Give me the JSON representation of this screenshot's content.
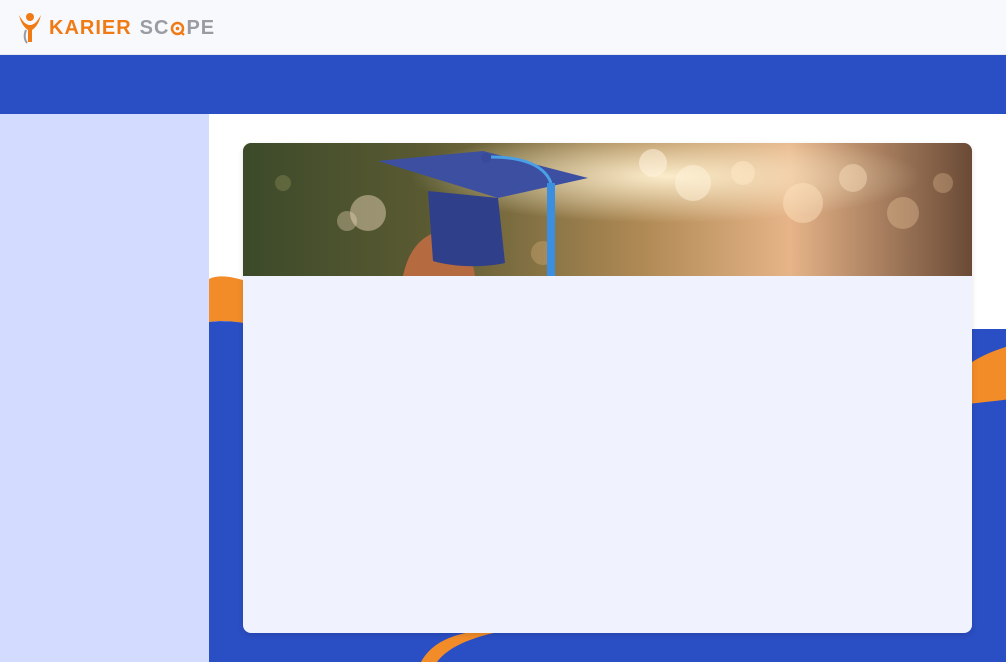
{
  "app": {
    "logo": {
      "word1": "KARIER",
      "word2_prefix": "SC",
      "word2_suffix": "PE",
      "word1_color": "#f07a14",
      "word2_color": "#9a9ca3"
    }
  },
  "colors": {
    "topbar": "#f8f9fc",
    "nav_band": "#2a4ec3",
    "sidebar": "#d3dbfe",
    "accent_orange": "#f28c28",
    "card": "#f0f2fd"
  },
  "banner": {
    "image": "graduation-cap-photo"
  }
}
